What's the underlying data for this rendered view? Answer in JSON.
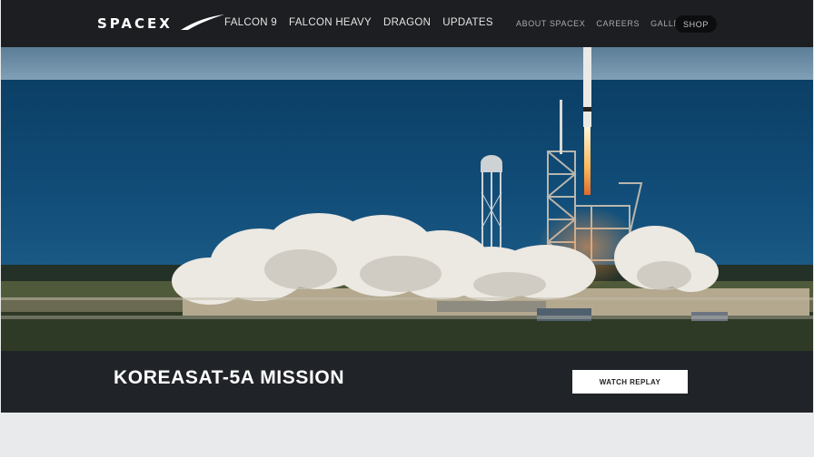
{
  "header": {
    "logo": "SPACEX",
    "nav_primary": [
      "FALCON 9",
      "FALCON HEAVY",
      "DRAGON",
      "UPDATES"
    ],
    "nav_secondary": [
      "ABOUT SPACEX",
      "CAREERS",
      "GALLERY"
    ],
    "shop_label": "SHOP"
  },
  "hero": {
    "mission_title": "KOREASAT-5A MISSION",
    "watch_label": "WATCH REPLAY"
  },
  "colors": {
    "header_bg": "#1c1e21",
    "ocean": "#0f4b77",
    "mission_bar": "#202428"
  }
}
